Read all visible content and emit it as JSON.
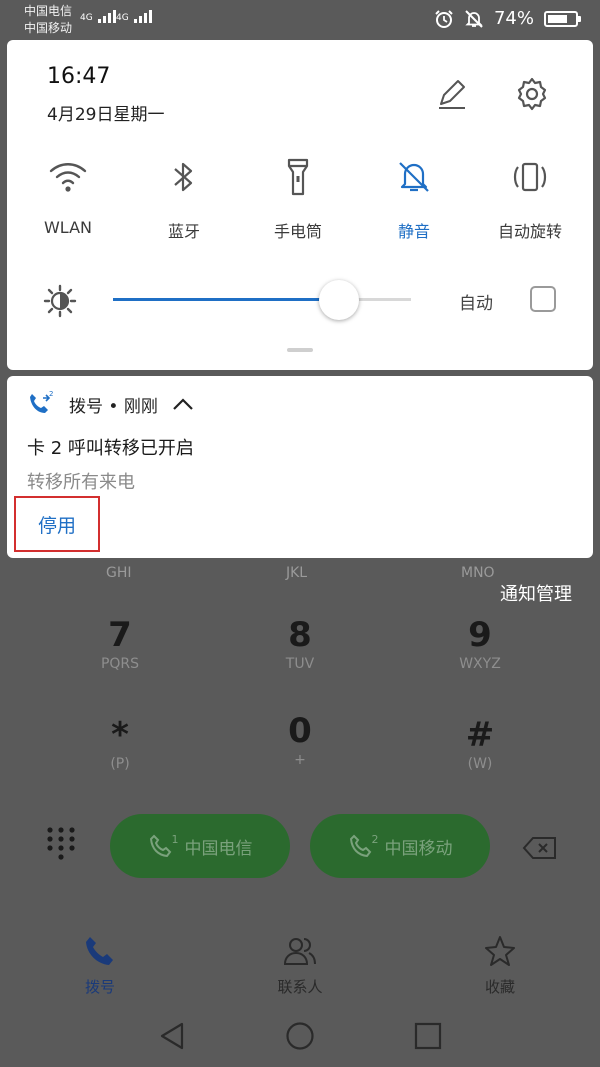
{
  "status_bar": {
    "carrier_1": "中国电信",
    "carrier_2": "中国移动",
    "network_1": "4G",
    "network_2": "4G",
    "battery_percent": "74%",
    "battery_level": 0.74
  },
  "quick_settings": {
    "time": "16:47",
    "date": "4月29日星期一",
    "tiles": [
      {
        "label": "WLAN",
        "icon": "wifi-icon",
        "active": false
      },
      {
        "label": "蓝牙",
        "icon": "bluetooth-icon",
        "active": false
      },
      {
        "label": "手电筒",
        "icon": "flashlight-icon",
        "active": false
      },
      {
        "label": "静音",
        "icon": "bell-off-icon",
        "active": true
      },
      {
        "label": "自动旋转",
        "icon": "rotate-icon",
        "active": false
      }
    ],
    "brightness": {
      "level": 0.76,
      "auto_label": "自动",
      "auto_checked": false
    },
    "accent_color": "#1f6fc5"
  },
  "notification": {
    "app": "拨号",
    "separator": "•",
    "time": "刚刚",
    "title": "卡 2 呼叫转移已开启",
    "body": "转移所有来电",
    "action": "停用"
  },
  "dialer": {
    "partial_letters": [
      "GHI",
      "JKL",
      "MNO"
    ],
    "notify_management": "通知管理",
    "keys": [
      {
        "digit": "7",
        "letters": "PQRS"
      },
      {
        "digit": "8",
        "letters": "TUV"
      },
      {
        "digit": "9",
        "letters": "WXYZ"
      },
      {
        "digit": "*",
        "letters": "(P)"
      },
      {
        "digit": "0",
        "letters": "+"
      },
      {
        "digit": "#",
        "letters": "(W)"
      }
    ],
    "call_buttons": [
      {
        "sim": "1",
        "label": "中国电信"
      },
      {
        "sim": "2",
        "label": "中国移动"
      }
    ],
    "call_color": "#2b6a2e"
  },
  "bottom_nav": [
    {
      "label": "拨号",
      "active": true
    },
    {
      "label": "联系人",
      "active": false
    },
    {
      "label": "收藏",
      "active": false
    }
  ]
}
